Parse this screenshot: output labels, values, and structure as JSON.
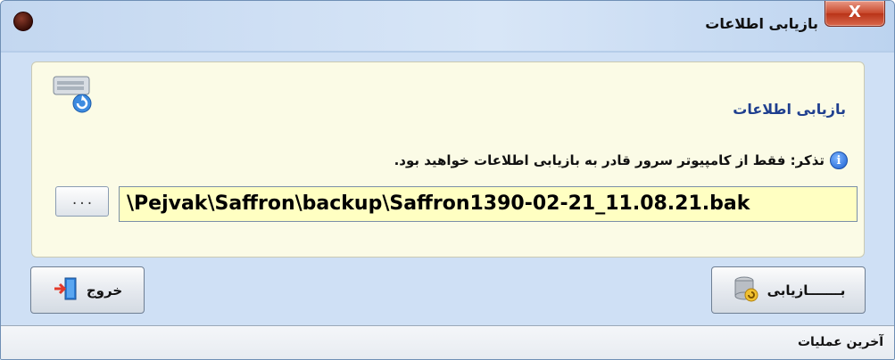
{
  "window": {
    "title": "بازیابی اطلاعات"
  },
  "titlebar": {
    "close_glyph": "X"
  },
  "content": {
    "heading": "بازیابی اطلاعات",
    "note_icon_glyph": "i",
    "note": "تذکر: فقط از کامپیوتر سرور قادر به بازیابی اطلاعات خواهید بود.",
    "path_value": "\\Pejvak\\Saffron\\backup\\Saffron1390-02-21_11.08.21.bak",
    "browse_label": "..."
  },
  "buttons": {
    "exit_label": "خروج",
    "restore_label": "بـــــــازیابی"
  },
  "status": {
    "text": "آخرین عملیات"
  },
  "icons": [
    "app-icon",
    "close-icon",
    "server-restore-icon",
    "info-icon",
    "exit-door-icon",
    "database-restore-icon"
  ]
}
